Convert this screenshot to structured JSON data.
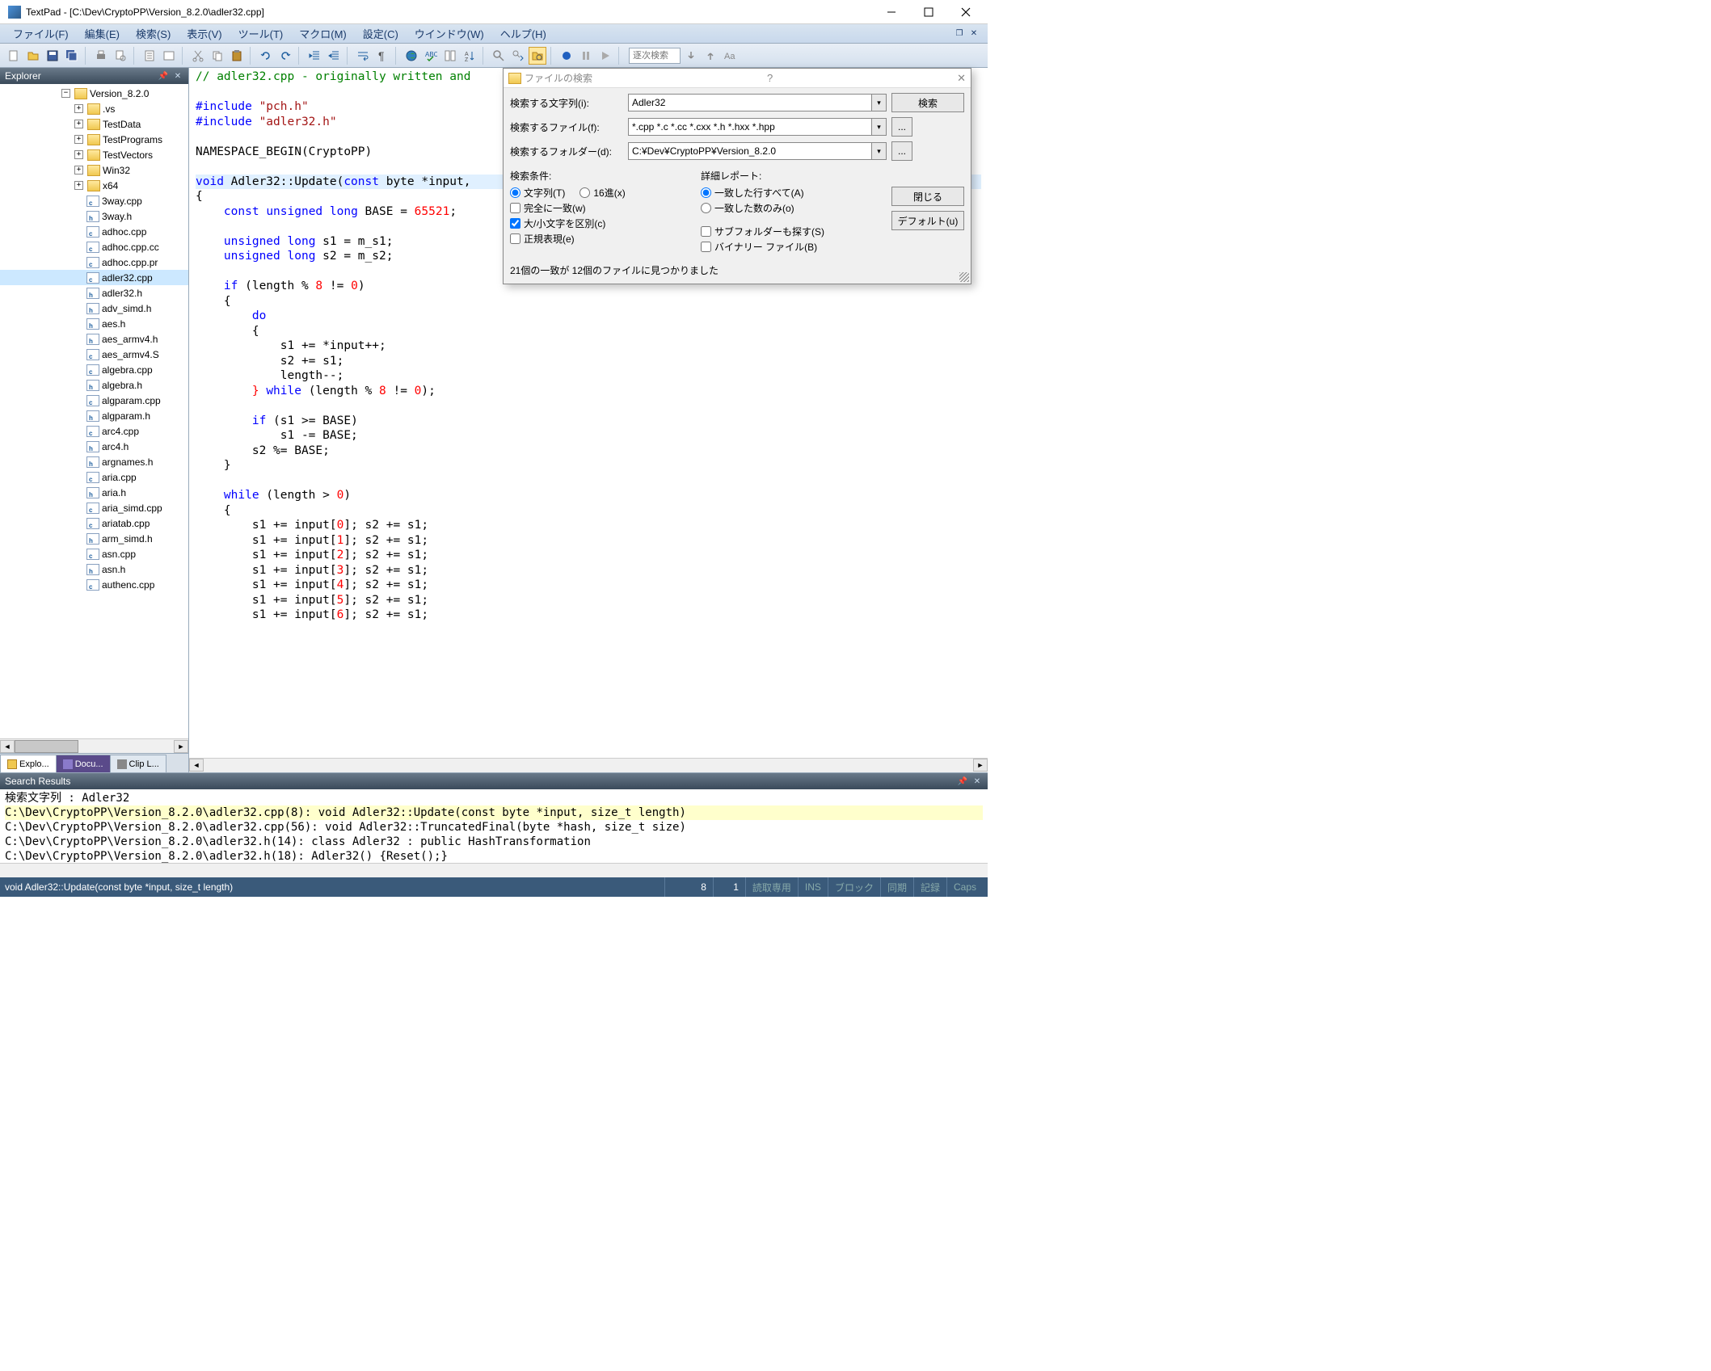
{
  "titlebar": {
    "app": "TextPad",
    "path": "[C:\\Dev\\CryptoPP\\Version_8.2.0\\adler32.cpp]"
  },
  "menu": {
    "file": "ファイル(F)",
    "edit": "編集(E)",
    "search": "検索(S)",
    "view": "表示(V)",
    "tools": "ツール(T)",
    "macros": "マクロ(M)",
    "config": "設定(C)",
    "window": "ウインドウ(W)",
    "help": "ヘルプ(H)"
  },
  "toolbar": {
    "search_placeholder": "逐次検索"
  },
  "explorer": {
    "title": "Explorer",
    "root": "Version_8.2.0",
    "folders": [
      ".vs",
      "TestData",
      "TestPrograms",
      "TestVectors",
      "Win32",
      "x64"
    ],
    "files": [
      {
        "n": "3way.cpp",
        "t": "c"
      },
      {
        "n": "3way.h",
        "t": "h"
      },
      {
        "n": "adhoc.cpp",
        "t": "c"
      },
      {
        "n": "adhoc.cpp.cc",
        "t": "c"
      },
      {
        "n": "adhoc.cpp.pr",
        "t": "c"
      },
      {
        "n": "adler32.cpp",
        "t": "c"
      },
      {
        "n": "adler32.h",
        "t": "h"
      },
      {
        "n": "adv_simd.h",
        "t": "h"
      },
      {
        "n": "aes.h",
        "t": "h"
      },
      {
        "n": "aes_armv4.h",
        "t": "h"
      },
      {
        "n": "aes_armv4.S",
        "t": "c"
      },
      {
        "n": "algebra.cpp",
        "t": "c"
      },
      {
        "n": "algebra.h",
        "t": "h"
      },
      {
        "n": "algparam.cpp",
        "t": "c"
      },
      {
        "n": "algparam.h",
        "t": "h"
      },
      {
        "n": "arc4.cpp",
        "t": "c"
      },
      {
        "n": "arc4.h",
        "t": "h"
      },
      {
        "n": "argnames.h",
        "t": "h"
      },
      {
        "n": "aria.cpp",
        "t": "c"
      },
      {
        "n": "aria.h",
        "t": "h"
      },
      {
        "n": "aria_simd.cpp",
        "t": "c"
      },
      {
        "n": "ariatab.cpp",
        "t": "c"
      },
      {
        "n": "arm_simd.h",
        "t": "h"
      },
      {
        "n": "asn.cpp",
        "t": "c"
      },
      {
        "n": "asn.h",
        "t": "h"
      },
      {
        "n": "authenc.cpp",
        "t": "c"
      }
    ],
    "tabs": {
      "explo": "Explo...",
      "docu": "Docu...",
      "clip": "Clip L..."
    }
  },
  "find": {
    "title": "ファイルの検索",
    "label_text": "検索する文字列(i):",
    "label_files": "検索するファイル(f):",
    "label_folder": "検索するフォルダー(d):",
    "value_text": "Adler32",
    "value_files": "*.cpp *.c *.cc *.cxx *.h *.hxx *.hpp",
    "value_folder": "C:¥Dev¥CryptoPP¥Version_8.2.0",
    "btn_search": "検索",
    "btn_close": "閉じる",
    "btn_default": "デフォルト(u)",
    "cond_title": "検索条件:",
    "cond_text": "文字列(T)",
    "cond_hex": "16進(x)",
    "cond_whole": "完全に一致(w)",
    "cond_case": "大/小文字を区別(c)",
    "cond_regex": "正規表現(e)",
    "rep_title": "詳細レポート:",
    "rep_all": "一致した行すべて(A)",
    "rep_count": "一致した数のみ(o)",
    "sub": "サブフォルダーも探す(S)",
    "bin": "バイナリー ファイル(B)",
    "status": "21個の一致が 12個のファイルに見つかりました"
  },
  "search_panel": {
    "title": "Search Results",
    "header": "検索文字列 : Adler32",
    "lines": [
      "C:\\Dev\\CryptoPP\\Version_8.2.0\\adler32.cpp(8): void Adler32::Update(const byte *input, size_t length)",
      "C:\\Dev\\CryptoPP\\Version_8.2.0\\adler32.cpp(56): void Adler32::TruncatedFinal(byte *hash, size_t size)",
      "C:\\Dev\\CryptoPP\\Version_8.2.0\\adler32.h(14): class Adler32 : public HashTransformation",
      "C:\\Dev\\CryptoPP\\Version_8.2.0\\adler32.h(18): Adler32() {Reset();}"
    ]
  },
  "statusbar": {
    "func": "void Adler32::Update(const byte *input, size_t length)",
    "line": "8",
    "col": "1",
    "readonly": "読取専用",
    "ins": "INS",
    "block": "ブロック",
    "sync": "同期",
    "rec": "記録",
    "caps": "Caps"
  }
}
